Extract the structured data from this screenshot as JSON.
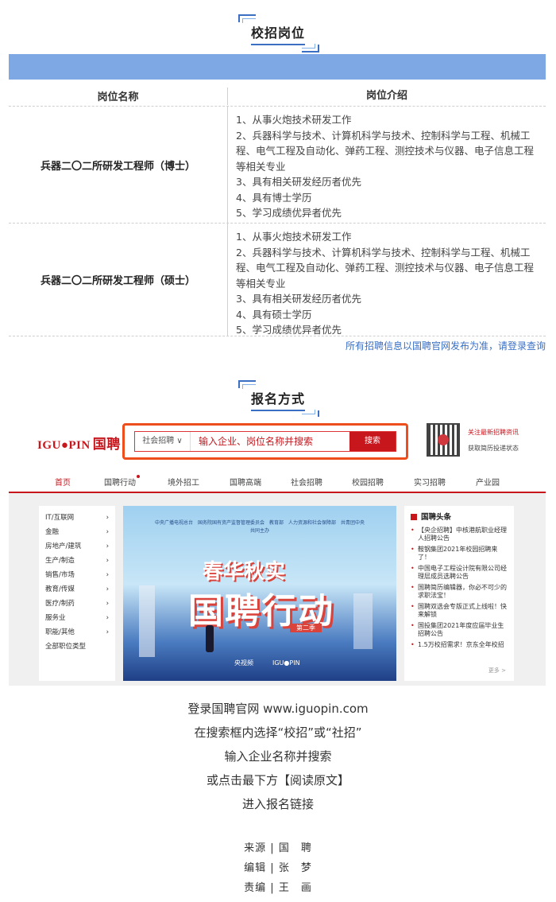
{
  "section1": {
    "title": "校招岗位"
  },
  "table": {
    "headers": [
      "岗位名称",
      "岗位介绍"
    ],
    "rows": [
      {
        "name": "兵器二〇二所研发工程师（博士）",
        "lines": [
          "1、从事火炮技术研发工作",
          "2、兵器科学与技术、计算机科学与技术、控制科学与工程、机械工程、电气工程及自动化、弹药工程、测控技术与仪器、电子信息工程等相关专业",
          "3、具有相关研发经历者优先",
          "4、具有博士学历",
          "5、学习成绩优异者优先"
        ]
      },
      {
        "name": "兵器二〇二所研发工程师（硕士）",
        "lines": [
          "1、从事火炮技术研发工作",
          "2、兵器科学与技术、计算机科学与技术、控制科学与工程、机械工程、电气工程及自动化、弹药工程、测控技术与仪器、电子信息工程等相关专业",
          "3、具有相关研发经历者优先",
          "4、具有硕士学历",
          "5、学习成绩优异者优先"
        ]
      }
    ],
    "note": "所有招聘信息以国聘官网发布为准，请登录查询"
  },
  "section2": {
    "title": "报名方式"
  },
  "shot": {
    "logo_en": "IGU●PIN",
    "logo_cn": "国聘",
    "select": "社会招聘 ∨",
    "search_placeholder": "输入企业、岗位名称并搜索",
    "search_btn": "搜索",
    "qr_text1": "关注最新招聘资讯",
    "qr_text2": "获取简历投递状态",
    "nav": [
      "首页",
      "国聘行动",
      "境外招工",
      "国聘高端",
      "社会招聘",
      "校园招聘",
      "实习招聘",
      "产业园"
    ],
    "categories": [
      "IT/互联网",
      "金融",
      "房地产/建筑",
      "生产/制造",
      "销售/市场",
      "教育/传媒",
      "医疗/制药",
      "服务业",
      "职能/其他",
      "全部职位类型"
    ],
    "banner_top": "中央广播电视总台　国务院国有资产监督管理委员会　教育部　人力资源和社会保障部　共青团中央",
    "banner_sub": "共同主办",
    "banner_big1": "春华秋实",
    "banner_big2": "国聘行动",
    "banner_season": "第二季",
    "banner_logos": "央视频　　　IGU●PIN",
    "news_head": "国聘头条",
    "news": [
      "【央企招聘】中核港航职业经理人招聘公告",
      "鞍钢集团2021年校园招聘来了！",
      "中国电子工程设计院有限公司经理层成员选聘公告",
      "国聘简历编辑器，你必不可少的求职法宝！",
      "国聘双选会专版正式上线啦！快来解锁",
      "国投集团2021年度应届毕业生招聘公告",
      "1.5万校招需求！京东全年校招"
    ],
    "news_more": "更多 >"
  },
  "instructions": [
    "登录国聘官网 www.iguopin.com",
    "在搜索框内选择“校招”或“社招”",
    "输入企业名称并搜索",
    "或点击最下方【阅读原文】",
    "进入报名链接"
  ],
  "credits": [
    "来源 | 国　聘",
    "编辑 | 张　梦",
    "责编 | 王　画"
  ]
}
